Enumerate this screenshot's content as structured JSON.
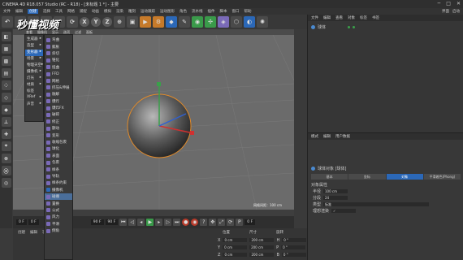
{
  "window": {
    "title": "CINEMA 4D R18.057 Studio (RC - R18) - [未标题 1 *] - 主要",
    "controls": [
      "─",
      "□",
      "✕"
    ]
  },
  "menubar": {
    "items": [
      "文件",
      "编辑",
      "创建",
      "选择",
      "工具",
      "网格",
      "捕捉",
      "动画",
      "模拟",
      "渲染",
      "雕刻",
      "运动跟踪",
      "运动图形",
      "角色",
      "流水线",
      "插件",
      "脚本",
      "窗口",
      "帮助"
    ],
    "layout_label": "界面",
    "layout_value": "启动"
  },
  "toolbar": {
    "x": "X",
    "y": "Y",
    "z": "Z"
  },
  "watermark": "秒懂视频",
  "viewport": {
    "menu": [
      "查看",
      "摄像机",
      "显示",
      "选项",
      "过滤",
      "面板"
    ],
    "grid_label": "网格间距：100 cm"
  },
  "menu1": {
    "items": [
      {
        "label": "生成器",
        "arrow": "▸"
      },
      {
        "label": "造型",
        "arrow": "▸"
      },
      {
        "label": "变形器",
        "arrow": "▸"
      },
      {
        "label": "场景",
        "arrow": "▸"
      },
      {
        "label": "物理天空",
        "arrow": "▸"
      },
      {
        "label": "摄像机",
        "arrow": "▸"
      },
      {
        "label": "灯光",
        "arrow": "▸"
      },
      {
        "label": "材质",
        "arrow": "▸"
      },
      {
        "label": "标签",
        "arrow": ""
      },
      {
        "label": "XRef",
        "arrow": "▸"
      },
      {
        "label": "声音",
        "arrow": "▸"
      }
    ]
  },
  "menu2": {
    "items": [
      {
        "label": "弯曲",
        "c": "p"
      },
      {
        "label": "膨胀",
        "c": "p"
      },
      {
        "label": "斜切",
        "c": "p"
      },
      {
        "label": "锥化",
        "c": "p"
      },
      {
        "label": "扭曲",
        "c": "p"
      },
      {
        "label": "FFD",
        "c": "p"
      },
      {
        "label": "网格",
        "c": "p"
      },
      {
        "label": "挤压&伸展",
        "c": "p"
      },
      {
        "label": "融解",
        "c": "p"
      },
      {
        "label": "爆炸",
        "c": "p"
      },
      {
        "label": "爆炸FX",
        "c": "p"
      },
      {
        "label": "破碎",
        "c": "p"
      },
      {
        "label": "修正",
        "c": "p"
      },
      {
        "label": "颤动",
        "c": "p"
      },
      {
        "label": "变形",
        "c": "p"
      },
      {
        "label": "收缩包裹",
        "c": "p"
      },
      {
        "label": "球化",
        "c": "p"
      },
      {
        "label": "表面",
        "c": "p"
      },
      {
        "label": "包裹",
        "c": "p"
      },
      {
        "label": "样条",
        "c": "p"
      },
      {
        "label": "导轨",
        "c": "p"
      },
      {
        "label": "样条约束",
        "c": "p"
      },
      {
        "label": "摄像机",
        "c": "b"
      },
      {
        "label": "碰撞",
        "c": "p"
      },
      {
        "label": "置换",
        "c": "p"
      },
      {
        "label": "公式",
        "c": "p"
      },
      {
        "label": "风力",
        "c": "p"
      },
      {
        "label": "平滑",
        "c": "p"
      },
      {
        "label": "倒角",
        "c": "p"
      }
    ]
  },
  "timeline": {
    "start": "0 F",
    "cur": "0 F",
    "end": "90 F",
    "end2": "90 F",
    "frame_right": "0 F"
  },
  "bottom": {
    "create": "创建",
    "edit": "编辑",
    "func": "功能",
    "texture": "纹理",
    "pos": "位置",
    "size": "尺寸",
    "rot": "旋转",
    "x": "X",
    "y": "Y",
    "z": "Z",
    "cm0": "0 cm",
    "cm200": "200 cm",
    "deg0": "0 °",
    "h": "H",
    "p": "P",
    "b": "B"
  },
  "objects": {
    "menu": [
      "文件",
      "编辑",
      "查看",
      "对象",
      "标签",
      "书签"
    ],
    "sphere": "球体"
  },
  "attr": {
    "menu": [
      "模式",
      "编辑",
      "用户数据"
    ],
    "title": "球体对象 [球体]",
    "tabs": [
      "基本",
      "坐标",
      "对象",
      "平滑着色(Phong)"
    ],
    "section": "对象属性",
    "props": [
      {
        "label": "半径",
        "value": "100 cm"
      },
      {
        "label": "分段",
        "value": "24"
      },
      {
        "label": "类型",
        "value": "标准"
      },
      {
        "label": "理想渲染",
        "value": "✓"
      }
    ]
  },
  "colors": {
    "accent": "#2b68b8",
    "sphere": "#6a6a6a",
    "orange": "#e08a2a"
  }
}
